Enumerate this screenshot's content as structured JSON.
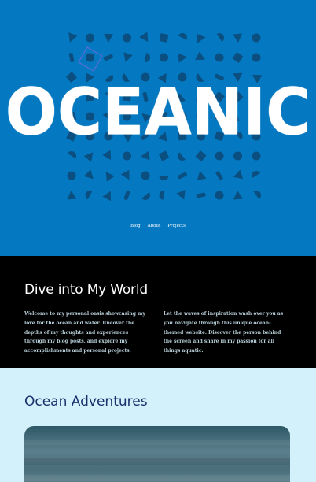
{
  "hero": {
    "logo": "OCEANIC",
    "background_color": "#0478c0",
    "nav": [
      {
        "label": "Blog"
      },
      {
        "label": "About"
      },
      {
        "label": "Projects"
      }
    ]
  },
  "intro": {
    "title": "Dive into My World",
    "paragraph_left": "Welcome to my personal oasis showcasing my love for the ocean and water. Uncover the depths of my thoughts and experiences through my blog posts, and explore my accomplishments and personal projects.",
    "paragraph_right": "Let the waves of inspiration wash over you as you navigate through this unique ocean-themed website. Discover the person behind the screen and share in my passion for all things aquatic."
  },
  "adventures": {
    "title": "Ocean Adventures",
    "title_color": "#1b2f6b"
  }
}
